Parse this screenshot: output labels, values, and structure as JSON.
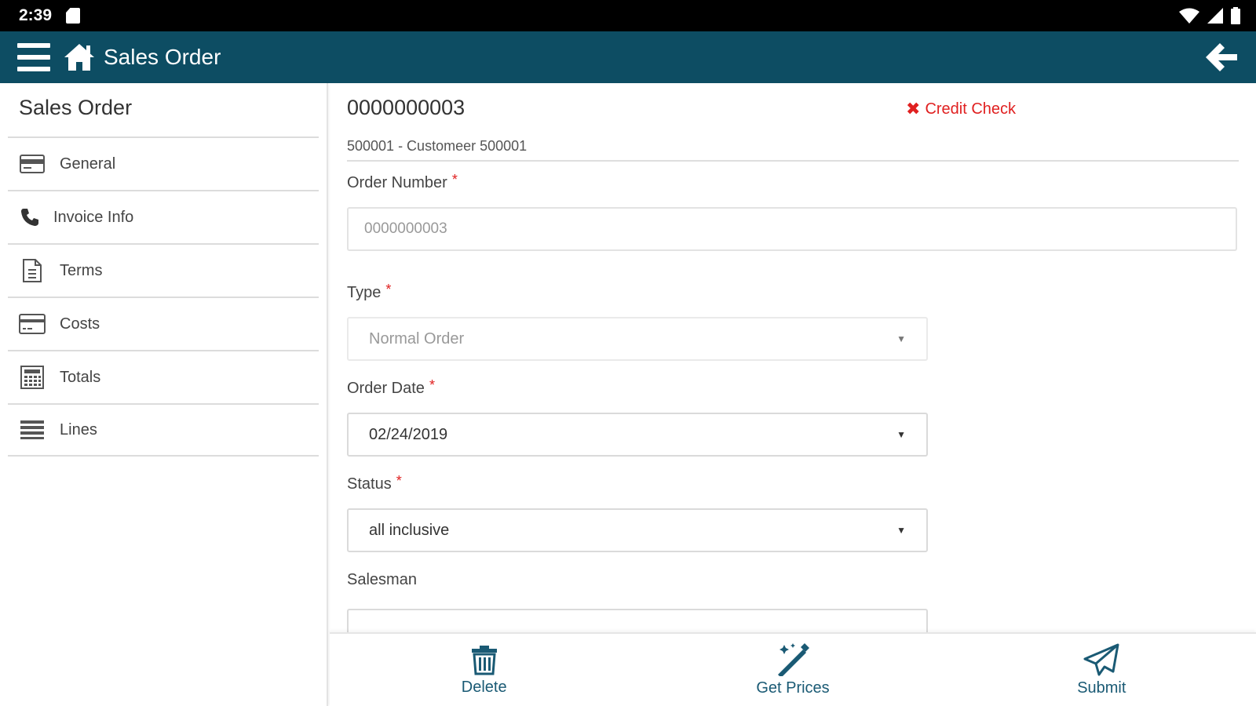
{
  "status_bar": {
    "time": "2:39"
  },
  "app_bar": {
    "title": "Sales Order"
  },
  "sidebar": {
    "title": "Sales Order",
    "items": [
      {
        "label": "General",
        "icon": "card-icon"
      },
      {
        "label": "Invoice Info",
        "icon": "phone-icon"
      },
      {
        "label": "Terms",
        "icon": "document-icon"
      },
      {
        "label": "Costs",
        "icon": "credit-card-icon"
      },
      {
        "label": "Totals",
        "icon": "calculator-icon"
      },
      {
        "label": "Lines",
        "icon": "list-icon"
      }
    ]
  },
  "order": {
    "id": "0000000003",
    "credit_check": "Credit Check",
    "customer": "500001 - Customeer 500001"
  },
  "form": {
    "order_number": {
      "label": "Order Number",
      "value": "0000000003"
    },
    "type": {
      "label": "Type",
      "value": "Normal Order"
    },
    "order_date": {
      "label": "Order Date",
      "value": "02/24/2019"
    },
    "status": {
      "label": "Status",
      "value": "all inclusive"
    },
    "salesman": {
      "label": "Salesman",
      "value": ""
    }
  },
  "actions": {
    "delete": "Delete",
    "get_prices": "Get Prices",
    "submit": "Submit"
  },
  "colors": {
    "app_bar": "#0d4d63",
    "action_text": "#1a5a74",
    "required": "#e02020"
  }
}
